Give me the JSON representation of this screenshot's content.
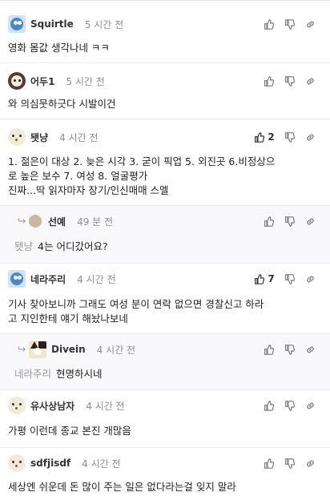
{
  "comments": [
    {
      "nickname": "Squirtle",
      "time": "5 시간 전",
      "body": "영화 몸값 생각나네 ㅋㅋ"
    },
    {
      "nickname": "어두1",
      "time": "5 시간 전",
      "body": "와 의심뭇하긋다 시발이건"
    },
    {
      "nickname": "됏냥",
      "time": "4 시간 전",
      "likes": "2",
      "body": "1. 젊은이 대상 2. 늦은 시각 3. 굳이 픽업 5. 외진곳 6.비정상으\n로 높은 보수 7. 여성 8. 얼굴평가\n진짜...딱 읽자마자 장기/인신매매 스멜"
    },
    {
      "nickname": "선예",
      "time": "49 분 전",
      "mention": "됏냥",
      "body": "4는 어디갔어요?"
    },
    {
      "nickname": "네라주리",
      "time": "4 시간 전",
      "likes": "7",
      "body": "기사 찾아보니까 그래도 여성 분이 연락 없으면 경찰신고 하라\n고 지인한테 얘기 해놨나보네"
    },
    {
      "nickname": "Divein",
      "time": "4 시간 전",
      "mention": "네라주리",
      "body": "현명하시네"
    },
    {
      "nickname": "유사상남자",
      "time": "4 시간 전",
      "body": "가평 이런데 종교 본진 개많음"
    },
    {
      "nickname": "sdfjisdf",
      "time": "4 시간 전",
      "body": "세상엔 쉬운데 돈 많이 주는 일은 없다라는걸 잊지 말라"
    }
  ],
  "icons": {
    "like": "thumbs-up-icon",
    "dislike": "thumbs-down-icon",
    "link": "link-icon",
    "reply": "reply-arrow-icon"
  },
  "colors": {
    "like_active": "#333333",
    "icon": "#777777",
    "time": "#8e8e8e",
    "mention": "#9a9a9a"
  }
}
